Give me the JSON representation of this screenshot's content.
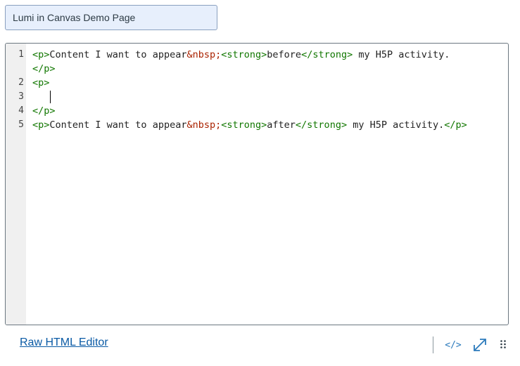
{
  "page_title_field": {
    "value": "Lumi in Canvas Demo Page"
  },
  "editor": {
    "line_numbers": [
      "1",
      "2",
      "3",
      "4",
      "5"
    ],
    "line1": {
      "open_p": "<p>",
      "text": "Content I want to appear",
      "entity": "&nbsp;",
      "open_strong": "<strong>",
      "strong_text": "before",
      "close_strong": "</strong>",
      "tail": " my H5P activity.",
      "close_p": "</p>"
    },
    "line2": {
      "open_p": "<p>"
    },
    "line4": {
      "close_p": "</p>"
    },
    "line5": {
      "open_p": "<p>",
      "text": "Content I want to appear",
      "entity": "&nbsp;",
      "open_strong": "<strong>",
      "strong_text": "after",
      "close_strong": "</strong>",
      "tail": " my H5P activity.",
      "close_p": "</p>"
    }
  },
  "footer": {
    "raw_html_link": "Raw HTML Editor",
    "code_toggle": "</>",
    "icons": [
      "code-view-icon",
      "fullscreen-expand-icon",
      "resize-grip-icon"
    ]
  },
  "colors": {
    "tag": "#117700",
    "entity": "#aa2200",
    "link": "#0a5aa5",
    "title_bg": "#e7effc"
  }
}
